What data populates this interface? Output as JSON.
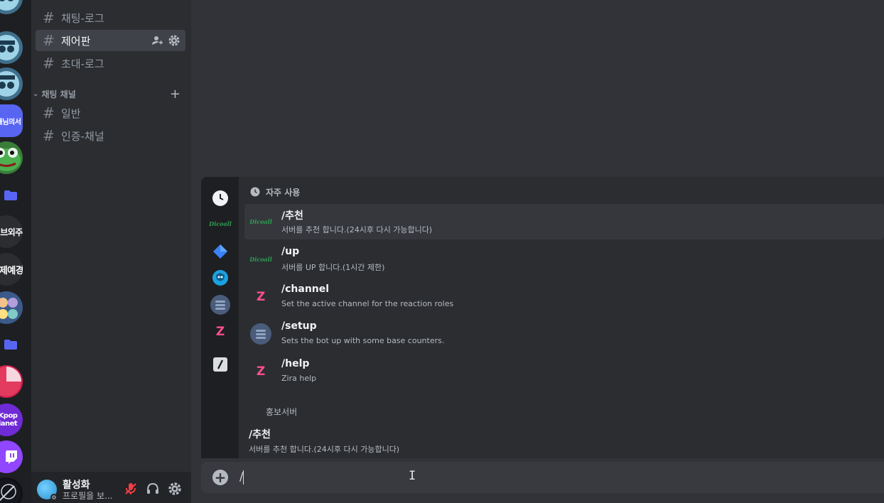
{
  "servers": [
    {
      "icon": "mascot-server-icon",
      "label": ""
    },
    {
      "icon": "mascot-server-icon",
      "label": ""
    },
    {
      "icon": "mascot-server-icon",
      "label": ""
    },
    {
      "icon": "text-server-icon",
      "label": "해님의서"
    },
    {
      "icon": "frog-server-icon",
      "label": ""
    },
    {
      "icon": "folder-icon",
      "label": ""
    },
    {
      "icon": "text-server-icon",
      "label": "브외주"
    },
    {
      "icon": "text-server-icon",
      "label": "제예경"
    },
    {
      "icon": "group-server-icon",
      "label": ""
    },
    {
      "icon": "folder-icon",
      "label": ""
    },
    {
      "icon": "red-server-icon",
      "label": ""
    },
    {
      "icon": "text-server-icon",
      "label": "Kpop\nlanet"
    },
    {
      "icon": "twitch-icon",
      "label": ""
    },
    {
      "icon": "dark-server-icon",
      "label": ""
    }
  ],
  "channels": {
    "top": [
      {
        "name": "채팅-로그",
        "active": false
      },
      {
        "name": "제어판",
        "active": true
      },
      {
        "name": "초대-로그",
        "active": false
      }
    ],
    "category": "채팅 채널",
    "category_channels": [
      {
        "name": "일반"
      },
      {
        "name": "인증-채널"
      }
    ]
  },
  "user": {
    "name": "활성화",
    "subtext": "프로필을 보..."
  },
  "command_popup": {
    "frequent_header": "자주 사용",
    "frequent": [
      {
        "name": "/추천",
        "desc": "서버를 추천 합니다.(24시후 다시 가능합니다)",
        "bot_icon": "dicoall-icon",
        "selected": true
      },
      {
        "name": "/up",
        "desc": "서버를 UP 합니다.(1시간 제한)",
        "bot_icon": "dicoall-icon",
        "selected": false
      },
      {
        "name": "/channel",
        "desc": "Set the active channel for the reaction roles",
        "bot_icon": "zira-icon",
        "selected": false
      },
      {
        "name": "/setup",
        "desc": "Sets the bot up with some base counters.",
        "bot_icon": "counter-bot-icon",
        "selected": false
      },
      {
        "name": "/help",
        "desc": "Zira help",
        "bot_icon": "zira-icon",
        "selected": false
      }
    ],
    "bot_section_header": "홍보서버",
    "bot_commands": [
      {
        "name": "/추천",
        "desc": "서버를 추천 합니다.(24시후 다시 가능합니다)"
      }
    ],
    "dicoall_logo": "Dicoall",
    "zira_logo": "Z"
  },
  "input": {
    "value": "/"
  }
}
